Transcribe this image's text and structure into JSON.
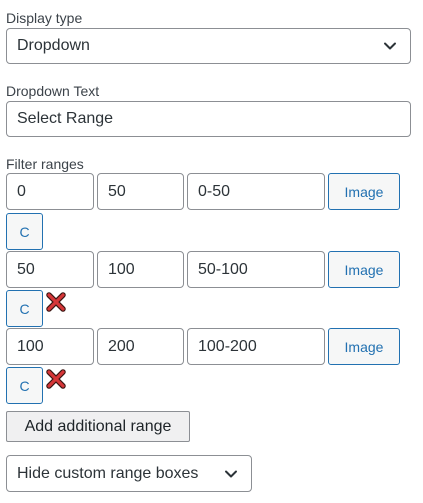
{
  "display_type": {
    "label": "Display type",
    "selected": "Dropdown"
  },
  "dropdown_text": {
    "label": "Dropdown Text",
    "value": "Select Range"
  },
  "filter_ranges": {
    "label": "Filter ranges",
    "rows": [
      {
        "min": "0",
        "max": "50",
        "text": "0-50",
        "image_button": "Image",
        "c_button": "C",
        "removable": false
      },
      {
        "min": "50",
        "max": "100",
        "text": "50-100",
        "image_button": "Image",
        "c_button": "C",
        "removable": true
      },
      {
        "min": "100",
        "max": "200",
        "text": "100-200",
        "image_button": "Image",
        "c_button": "C",
        "removable": true
      }
    ]
  },
  "add_range_button": "Add additional range",
  "custom_range_select": {
    "selected": "Hide custom range boxes"
  },
  "colors": {
    "accent": "#2271b1",
    "remove": "#d63638",
    "border": "#8c8f94"
  },
  "icons": {
    "select_arrow": "chevron-down-icon",
    "remove": "close-icon"
  }
}
